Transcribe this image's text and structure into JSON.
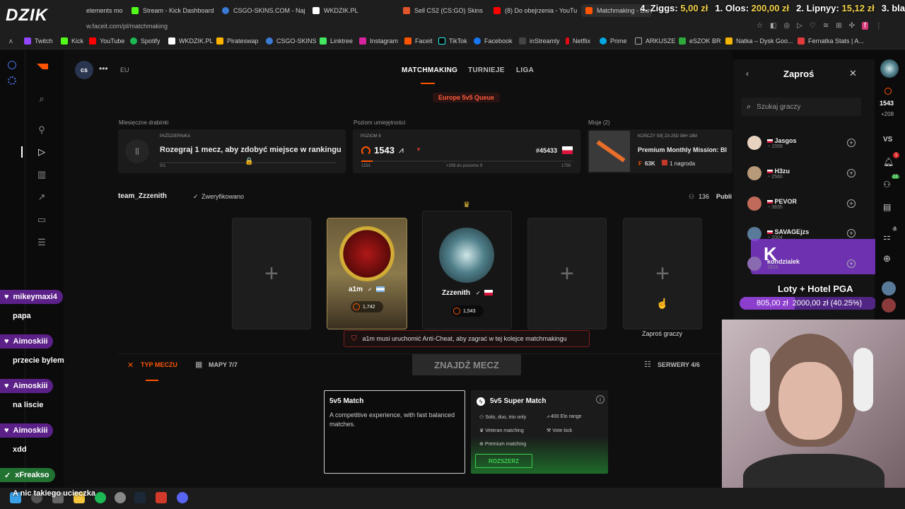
{
  "browser": {
    "tabs": [
      {
        "label": "elements mo",
        "active": false
      },
      {
        "label": "Stream - Kick Dashboard",
        "active": false
      },
      {
        "label": "CSGO-SKINS.COM - Naj",
        "active": false
      },
      {
        "label": "WKDZIK.PL",
        "active": false
      },
      {
        "label": "Sell CS2 (CS:GO) Skins",
        "active": false
      },
      {
        "label": "(8) Do obejrzenia - YouTu",
        "active": false
      },
      {
        "label": "Matchmaking - Europe",
        "active": true
      }
    ],
    "url": "w.faceit.com/pl/matchmaking",
    "bookmarks": [
      "Twitch",
      "Kick",
      "YouTube",
      "Spotify",
      "WKDZIK.PL",
      "Pirateswap",
      "CSGO-SKINS",
      "Linktree",
      "Instagram",
      "Faceit",
      "TikTok",
      "Facebook",
      "inStreamly",
      "Netflix",
      "Prime",
      "ARKUSZE",
      "eSZOK BR",
      "Natka – Dysk Goo...",
      "Fernatka Stats | A..."
    ]
  },
  "overlay": {
    "logo": "DZIK",
    "ticker": [
      {
        "rank": "4. Ziggs:",
        "amount": "5,00 zł"
      },
      {
        "rank": "1. Olos:",
        "amount": "200,00 zł"
      },
      {
        "rank": "2. Lipnyy:",
        "amount": "15,12 zł"
      },
      {
        "rank": "3. bla",
        "amount": ""
      }
    ],
    "chat": [
      {
        "name": "mikeymaxi4",
        "message": "papa"
      },
      {
        "name": "Aimoskiii",
        "message": "przecie bylem"
      },
      {
        "name": "Aimoskiii",
        "message": "na liscie"
      },
      {
        "name": "Aimoskiii",
        "message": "xdd"
      },
      {
        "name": "xFreakso",
        "message": "A nic takiego ucieczka"
      }
    ],
    "goal": {
      "title": "Loty + Hotel PGA",
      "progress": "805,00 zł  2000,00 zł (40.25%)",
      "fraction": 0.4025
    },
    "highlight_user": "kondzialek"
  },
  "faceit": {
    "region": "EU",
    "nav": [
      "MATCHMAKING",
      "TURNIEJE",
      "LIGA"
    ],
    "queue_badge": "Europe 5v5 Queue",
    "ladder": {
      "section": "Miesięczne drabinki",
      "month": "PAŹDZIERNIKA",
      "text": "Rozegraj 1 mecz, aby zdobyć miejsce w rankingu",
      "progress": "0/1"
    },
    "skill": {
      "section": "Poziom umiejętności",
      "level": "POZIOM 8",
      "elo": "1543",
      "rank": "#45433",
      "min": "1531",
      "to_next": "+208 do poziomu 9",
      "max": "1750"
    },
    "missions": {
      "section": "Misje (2)",
      "ends": "KOŃCZY SIĘ ZA 25D 08H 18M",
      "title": "Premium Monthly Mission: Bl",
      "points": "63K",
      "reward": "1 nagroda"
    },
    "team": {
      "name": "team_Zzzenith",
      "verified": "Zweryfikowano",
      "count": "136",
      "visibility": "Publi"
    },
    "players": [
      {
        "name": "a1m",
        "elo": "1,742"
      },
      {
        "name": "Zzzenith",
        "elo": "1,543"
      }
    ],
    "invite_label": "Zaproś graczy",
    "warning": "a1m musi uruchomić Anti-Cheat, aby zagrać w tej kolejce matchmakingu",
    "bottom": {
      "match_type": "TYP MECZU",
      "maps": "MAPY 7/7",
      "find": "ZNAJDŹ MECZ",
      "servers": "SERWERY 4/6"
    },
    "modes": [
      {
        "title": "5v5 Match",
        "desc": "A competitive experience, with fast balanced matches."
      },
      {
        "title": "5v5 Super Match",
        "features": [
          "Solo, duo, trio only",
          "400 Elo range",
          "Veteran matching",
          "Vote kick",
          "Premium matching"
        ],
        "button": "ROZSZERZ"
      }
    ]
  },
  "invite_panel": {
    "title": "Zaproś",
    "search_placeholder": "Szukaj graczy",
    "players": [
      {
        "name": "Jasgos",
        "elo": "1559"
      },
      {
        "name": "H3zu",
        "elo": "2560"
      },
      {
        "name": "PEVOR",
        "elo": "3835"
      },
      {
        "name": "SAVAGEjzs",
        "elo": "2004"
      },
      {
        "name": "kondzialek",
        "elo": "1915"
      }
    ]
  },
  "right_rail": {
    "elo": "1543",
    "diff": "+208",
    "vs": "VS",
    "notif_count": "1",
    "friends_count": "22",
    "party_count": "2"
  },
  "colors": {
    "accent": "#ff5500",
    "chat_bg": "#7a28b4",
    "warning_border": "#c0392b",
    "green": "#2eaa3c"
  }
}
